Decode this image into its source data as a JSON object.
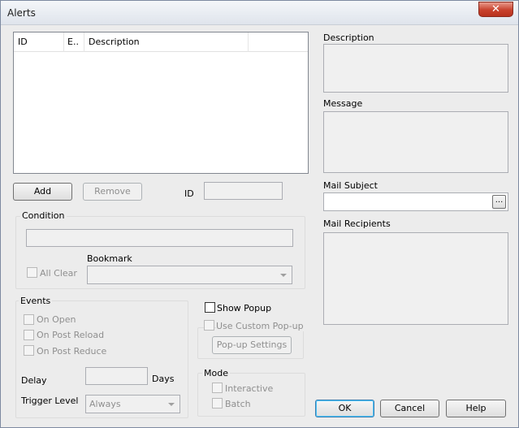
{
  "window": {
    "title": "Alerts",
    "close_glyph": "✕"
  },
  "alert_list": {
    "columns": [
      "ID",
      "E..",
      "Description",
      ""
    ]
  },
  "buttons": {
    "add": "Add",
    "remove": "Remove",
    "popup_settings": "Pop-up Settings",
    "ok": "OK",
    "cancel": "Cancel",
    "help": "Help",
    "browse": "..."
  },
  "id_label": "ID",
  "condition": {
    "title": "Condition",
    "bookmark_label": "Bookmark",
    "all_clear": "All Clear"
  },
  "events": {
    "title": "Events",
    "on_open": "On Open",
    "on_post_reload": "On Post Reload",
    "on_post_reduce": "On Post Reduce",
    "delay_label": "Delay",
    "days_label": "Days",
    "trigger_level_label": "Trigger Level",
    "trigger_level_value": "Always"
  },
  "popup": {
    "show_popup": "Show Popup",
    "use_custom": "Use Custom Pop-up"
  },
  "mode": {
    "title": "Mode",
    "interactive": "Interactive",
    "batch": "Batch"
  },
  "right_panel": {
    "description": "Description",
    "message": "Message",
    "mail_subject": "Mail Subject",
    "mail_recipients": "Mail Recipients"
  }
}
